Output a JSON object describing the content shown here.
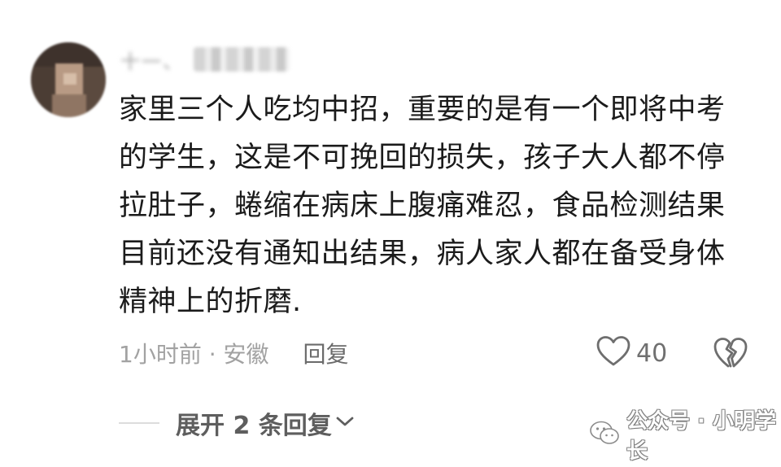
{
  "comment": {
    "author_name": "十一、",
    "body": "家里三个人吃均中招，重要的是有一个即将中考的学生，这是不可挽回的损失，孩子大人都不停拉肚子，蜷缩在病床上腹痛难忍，食品检测结果目前还没有通知出结果，病人家人都在备受身体精神上的折磨.",
    "time_location": "1小时前 · 安徽",
    "reply_label": "回复",
    "like_count": "40",
    "expand_replies_label": "展开 2 条回复"
  },
  "watermark": {
    "text": "公众号 · 小明学长"
  },
  "colors": {
    "text_primary": "#1b1b1b",
    "text_secondary": "#a2a2a2",
    "icon_stroke": "#6e6e6e"
  },
  "icons": {
    "like": "heart-outline-icon",
    "dislike": "broken-heart-icon",
    "expand": "chevron-down-icon",
    "watermark": "wechat-icon"
  }
}
